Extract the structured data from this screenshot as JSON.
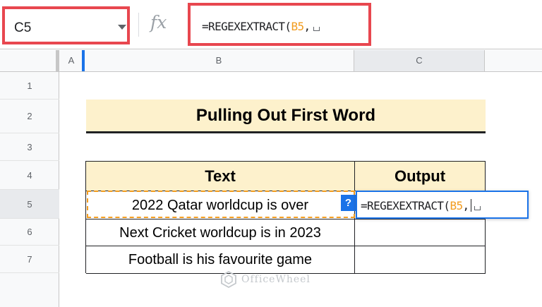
{
  "formula_bar": {
    "name_box": "C5",
    "fx_label": "fx",
    "formula_prefix": "=REGEXEXTRACT(",
    "formula_ref": "B5",
    "formula_suffix": ","
  },
  "columns": [
    "A",
    "B",
    "C"
  ],
  "rows": [
    "1",
    "2",
    "3",
    "4",
    "5",
    "6",
    "7"
  ],
  "sheet": {
    "title": "Pulling Out First Word",
    "headers": {
      "text": "Text",
      "output": "Output"
    },
    "data_rows": [
      {
        "text": "2022 Qatar worldcup is over",
        "output": ""
      },
      {
        "text": "Next Cricket worldcup is in 2023",
        "output": ""
      },
      {
        "text": "Football is his favourite game",
        "output": ""
      }
    ]
  },
  "editor": {
    "help_badge": "?",
    "formula_prefix": "=REGEXEXTRACT(",
    "formula_ref": "B5",
    "formula_suffix": ","
  },
  "watermark": "OfficeWheel",
  "colors": {
    "highlight_border": "#e8474f",
    "header_fill": "#fdf1cc",
    "cell_reference": "#f29c1f",
    "selection_blue": "#1a73e8"
  }
}
